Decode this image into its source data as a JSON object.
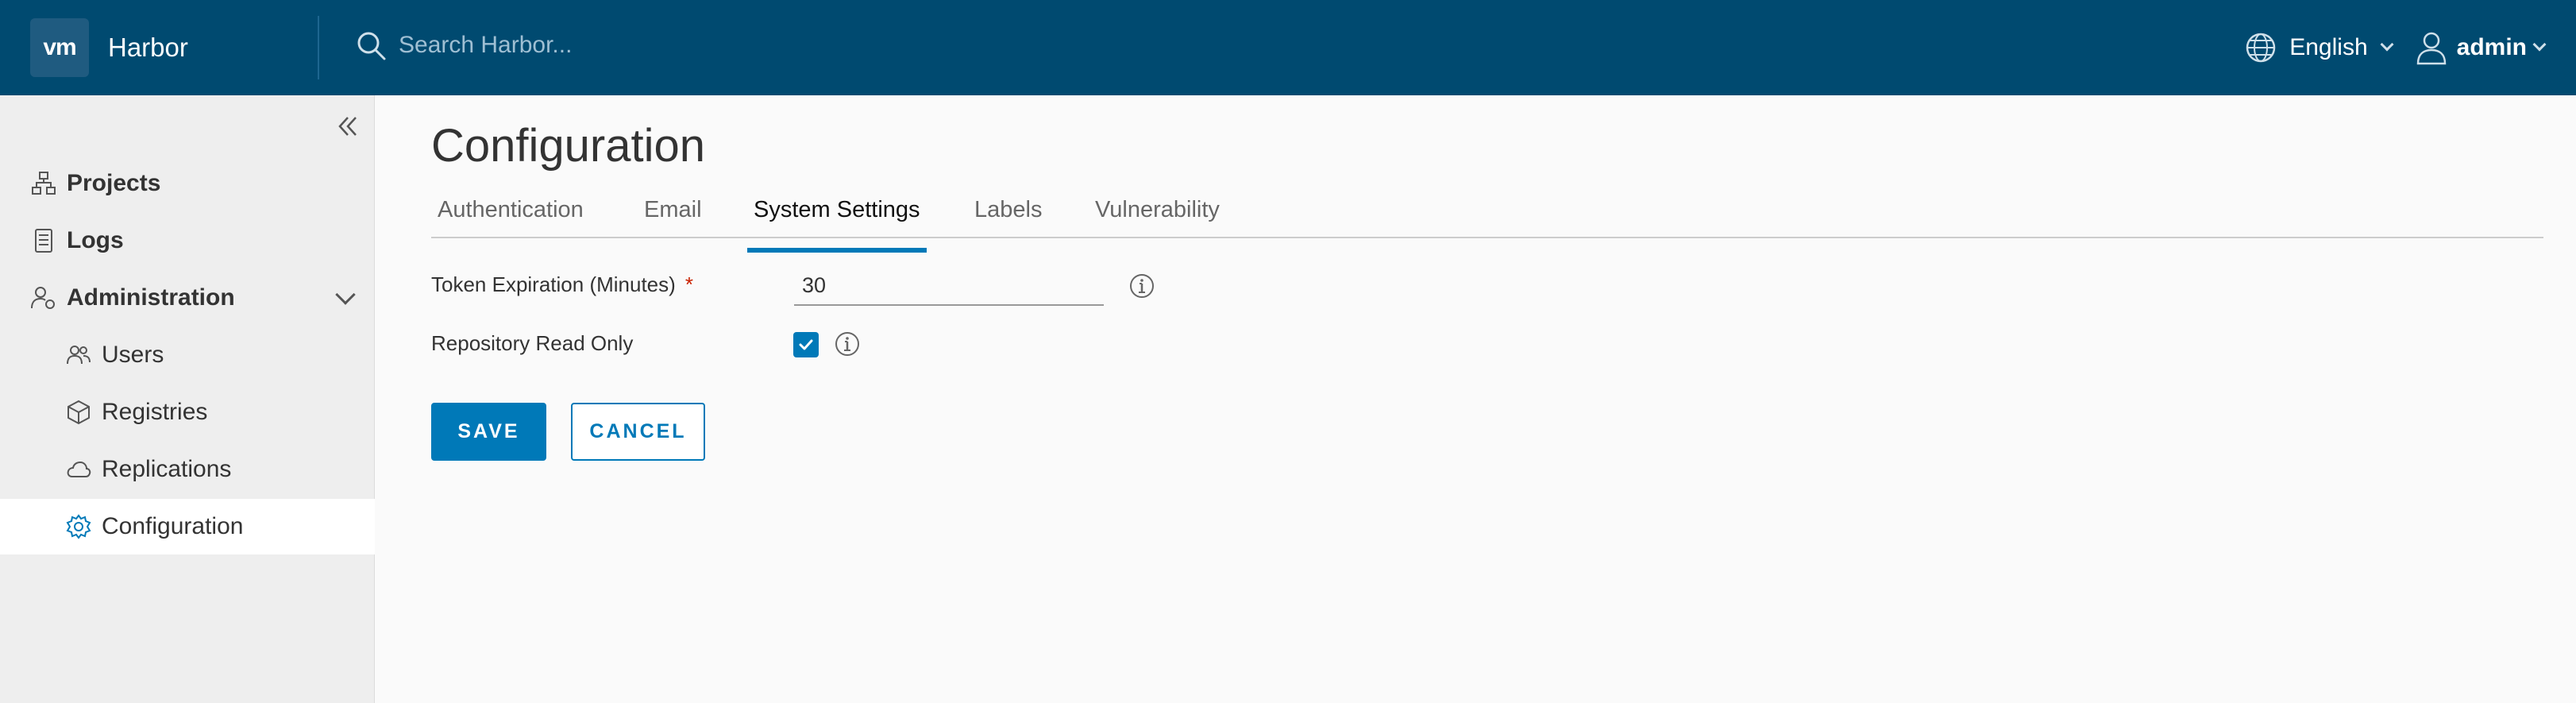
{
  "header": {
    "logo_text": "vm",
    "app_name": "Harbor",
    "search_placeholder": "Search Harbor...",
    "language": "English",
    "user": "admin",
    "background_color": "#004a70"
  },
  "sidebar": {
    "items": [
      {
        "label": "Projects",
        "icon": "projects-icon"
      },
      {
        "label": "Logs",
        "icon": "logs-icon"
      },
      {
        "label": "Administration",
        "icon": "administration-icon",
        "expanded": true
      },
      {
        "label": "Users",
        "icon": "users-icon"
      },
      {
        "label": "Registries",
        "icon": "registries-icon"
      },
      {
        "label": "Replications",
        "icon": "replications-icon"
      },
      {
        "label": "Configuration",
        "icon": "gear-icon",
        "active": true
      }
    ]
  },
  "main": {
    "title": "Configuration",
    "tabs": [
      {
        "label": "Authentication"
      },
      {
        "label": "Email"
      },
      {
        "label": "System Settings",
        "active": true
      },
      {
        "label": "Labels"
      },
      {
        "label": "Vulnerability"
      }
    ],
    "form": {
      "token_label": "Token Expiration (Minutes)",
      "required_mark": "*",
      "token_value": "30",
      "readonly_label": "Repository Read Only",
      "readonly_checked": true
    },
    "buttons": {
      "save": "SAVE",
      "cancel": "CANCEL"
    }
  },
  "colors": {
    "accent": "#0079b8",
    "required": "#c92100"
  }
}
